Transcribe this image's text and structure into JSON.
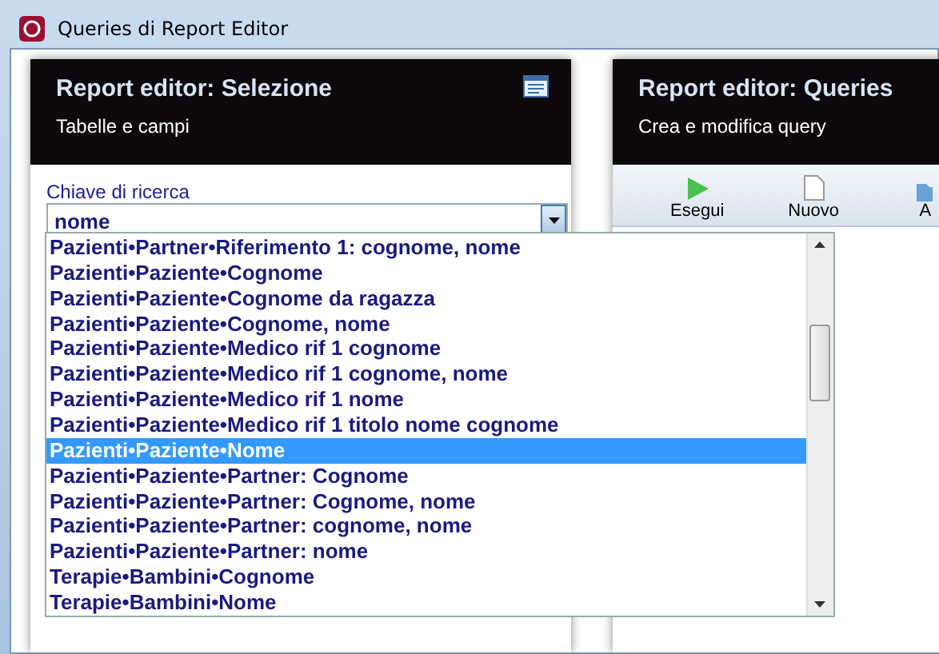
{
  "window": {
    "title": "Queries di Report Editor"
  },
  "left_panel": {
    "title": "Report editor: Selezione",
    "subtitle": "Tabelle e campi"
  },
  "search": {
    "label": "Chiave di ricerca",
    "value": "nome"
  },
  "results": [
    {
      "text": "Pazienti•Partner•Riferimento 1: cognome, nome",
      "selected": false
    },
    {
      "text": "Pazienti•Paziente•Cognome",
      "selected": false
    },
    {
      "text": "Pazienti•Paziente•Cognome da ragazza",
      "selected": false
    },
    {
      "text": "Pazienti•Paziente•Cognome, nome",
      "selected": false
    },
    {
      "text": "Pazienti•Paziente•Medico rif 1 cognome",
      "selected": false
    },
    {
      "text": "Pazienti•Paziente•Medico rif 1 cognome, nome",
      "selected": false
    },
    {
      "text": "Pazienti•Paziente•Medico rif 1 nome",
      "selected": false
    },
    {
      "text": "Pazienti•Paziente•Medico rif 1 titolo nome cognome",
      "selected": false
    },
    {
      "text": "Pazienti•Paziente•Nome",
      "selected": true
    },
    {
      "text": "Pazienti•Paziente•Partner: Cognome",
      "selected": false
    },
    {
      "text": "Pazienti•Paziente•Partner: Cognome, nome",
      "selected": false
    },
    {
      "text": "Pazienti•Paziente•Partner: cognome, nome",
      "selected": false
    },
    {
      "text": "Pazienti•Paziente•Partner: nome",
      "selected": false
    },
    {
      "text": "Terapie•Bambini•Cognome",
      "selected": false
    },
    {
      "text": "Terapie•Bambini•Nome",
      "selected": false
    }
  ],
  "right_panel": {
    "title": "Report editor: Queries",
    "subtitle": "Crea e modifica query"
  },
  "toolbar": [
    {
      "kind": "run",
      "label": "Esegui"
    },
    {
      "kind": "new",
      "label": "Nuovo"
    },
    {
      "kind": "open",
      "label": "A"
    }
  ]
}
